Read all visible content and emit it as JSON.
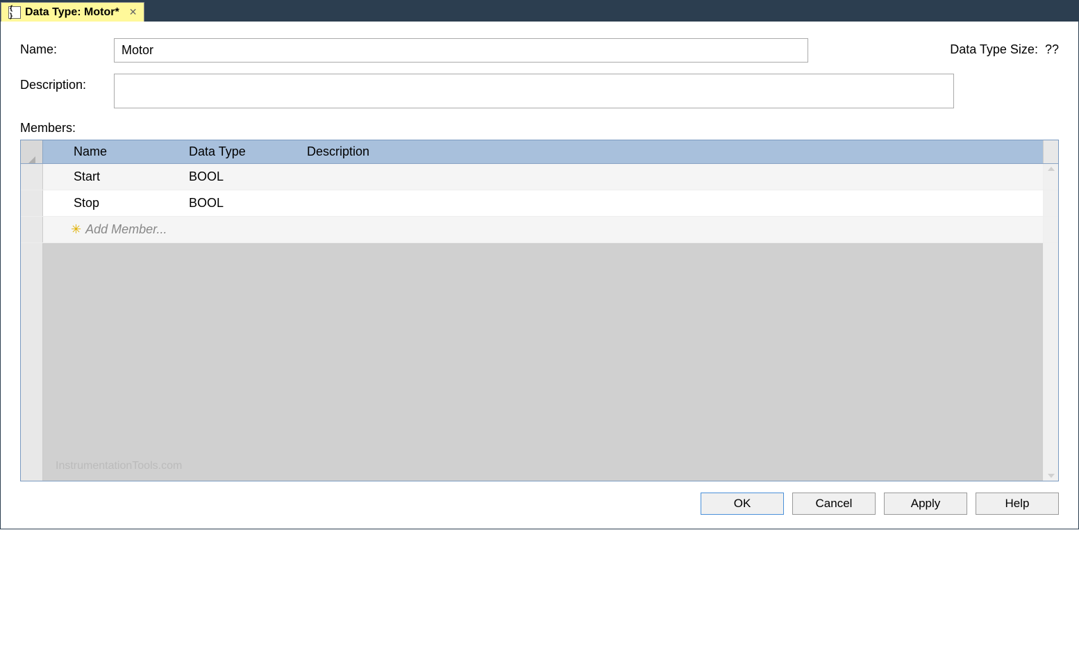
{
  "tab": {
    "title": "Data Type:  Motor*"
  },
  "form": {
    "name_label": "Name:",
    "name_value": "Motor",
    "description_label": "Description:",
    "description_value": "",
    "size_label": "Data Type Size:",
    "size_value": "??"
  },
  "members": {
    "label": "Members:",
    "columns": {
      "name": "Name",
      "type": "Data Type",
      "desc": "Description"
    },
    "rows": [
      {
        "name": "Start",
        "type": "BOOL",
        "desc": ""
      },
      {
        "name": "Stop",
        "type": "BOOL",
        "desc": ""
      }
    ],
    "add_label": "Add Member..."
  },
  "buttons": {
    "ok": "OK",
    "cancel": "Cancel",
    "apply": "Apply",
    "help": "Help"
  },
  "watermark": "InstrumentationTools.com"
}
